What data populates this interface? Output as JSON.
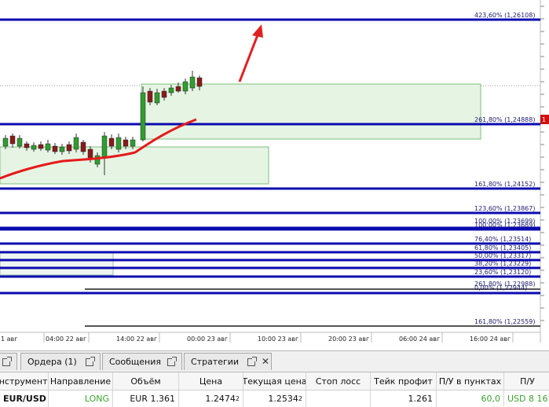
{
  "colors": {
    "fib_line": "#0b0bb0",
    "fib_line_gray": "#555555",
    "ma_line": "#e41b1b",
    "candle_up": "#2f9e2f",
    "candle_down": "#8a1a1a",
    "box_fill": "#e6f4e4",
    "box_stroke": "#7fbf7a",
    "arrow": "#e02020",
    "current_price_tag": "#d01010"
  },
  "fib_levels": [
    {
      "label": "423,60% (1,26108)"
    },
    {
      "label": "261,80% (1,24888)"
    },
    {
      "label": "161,80% (1,24152)"
    },
    {
      "label": "123,60% (1,23867)"
    },
    {
      "label": "100,00% (1,23699)"
    },
    {
      "label": "100,00% (1,23689)"
    },
    {
      "label": "76,40% (1,23514)"
    },
    {
      "label": "61,80% (1,23405)"
    },
    {
      "label": "50,00% (1,23317)"
    },
    {
      "label": "38,20% (1,23229)"
    },
    {
      "label": "23,60% (1,23120)"
    },
    {
      "label": "261,80% (1,22988)"
    },
    {
      "label": "0,00% (1,22944)"
    },
    {
      "label": "161,80% (1,22559)"
    }
  ],
  "time_axis": [
    "1 авг",
    "04:00 22 авг",
    "14:00 22 авг",
    "00:00 23 авг",
    "10:00 23 авг",
    "20:00 23 авг",
    "06:00 24 авг",
    "16:00 24 авг"
  ],
  "tabs": [
    {
      "label": ""
    },
    {
      "label": "Ордера (1)"
    },
    {
      "label": "Сообщения"
    },
    {
      "label": "Стратегии"
    }
  ],
  "table": {
    "headers": [
      "Инструмент",
      "Направление",
      "Объём",
      "Цена",
      "Текущая цена",
      "Стоп лосс",
      "Тейк профит",
      "П/У в пунктах",
      "П/У"
    ],
    "row": {
      "instrument": "EUR/USD",
      "direction": "LONG",
      "volume": "EUR 1.361",
      "price": "1.2474",
      "price_small": "2",
      "current": "1.2534",
      "current_small": "2",
      "stop_loss": "",
      "take_profit": "1.261",
      "pips": "60,0",
      "pnl": "USD 8 16"
    }
  }
}
